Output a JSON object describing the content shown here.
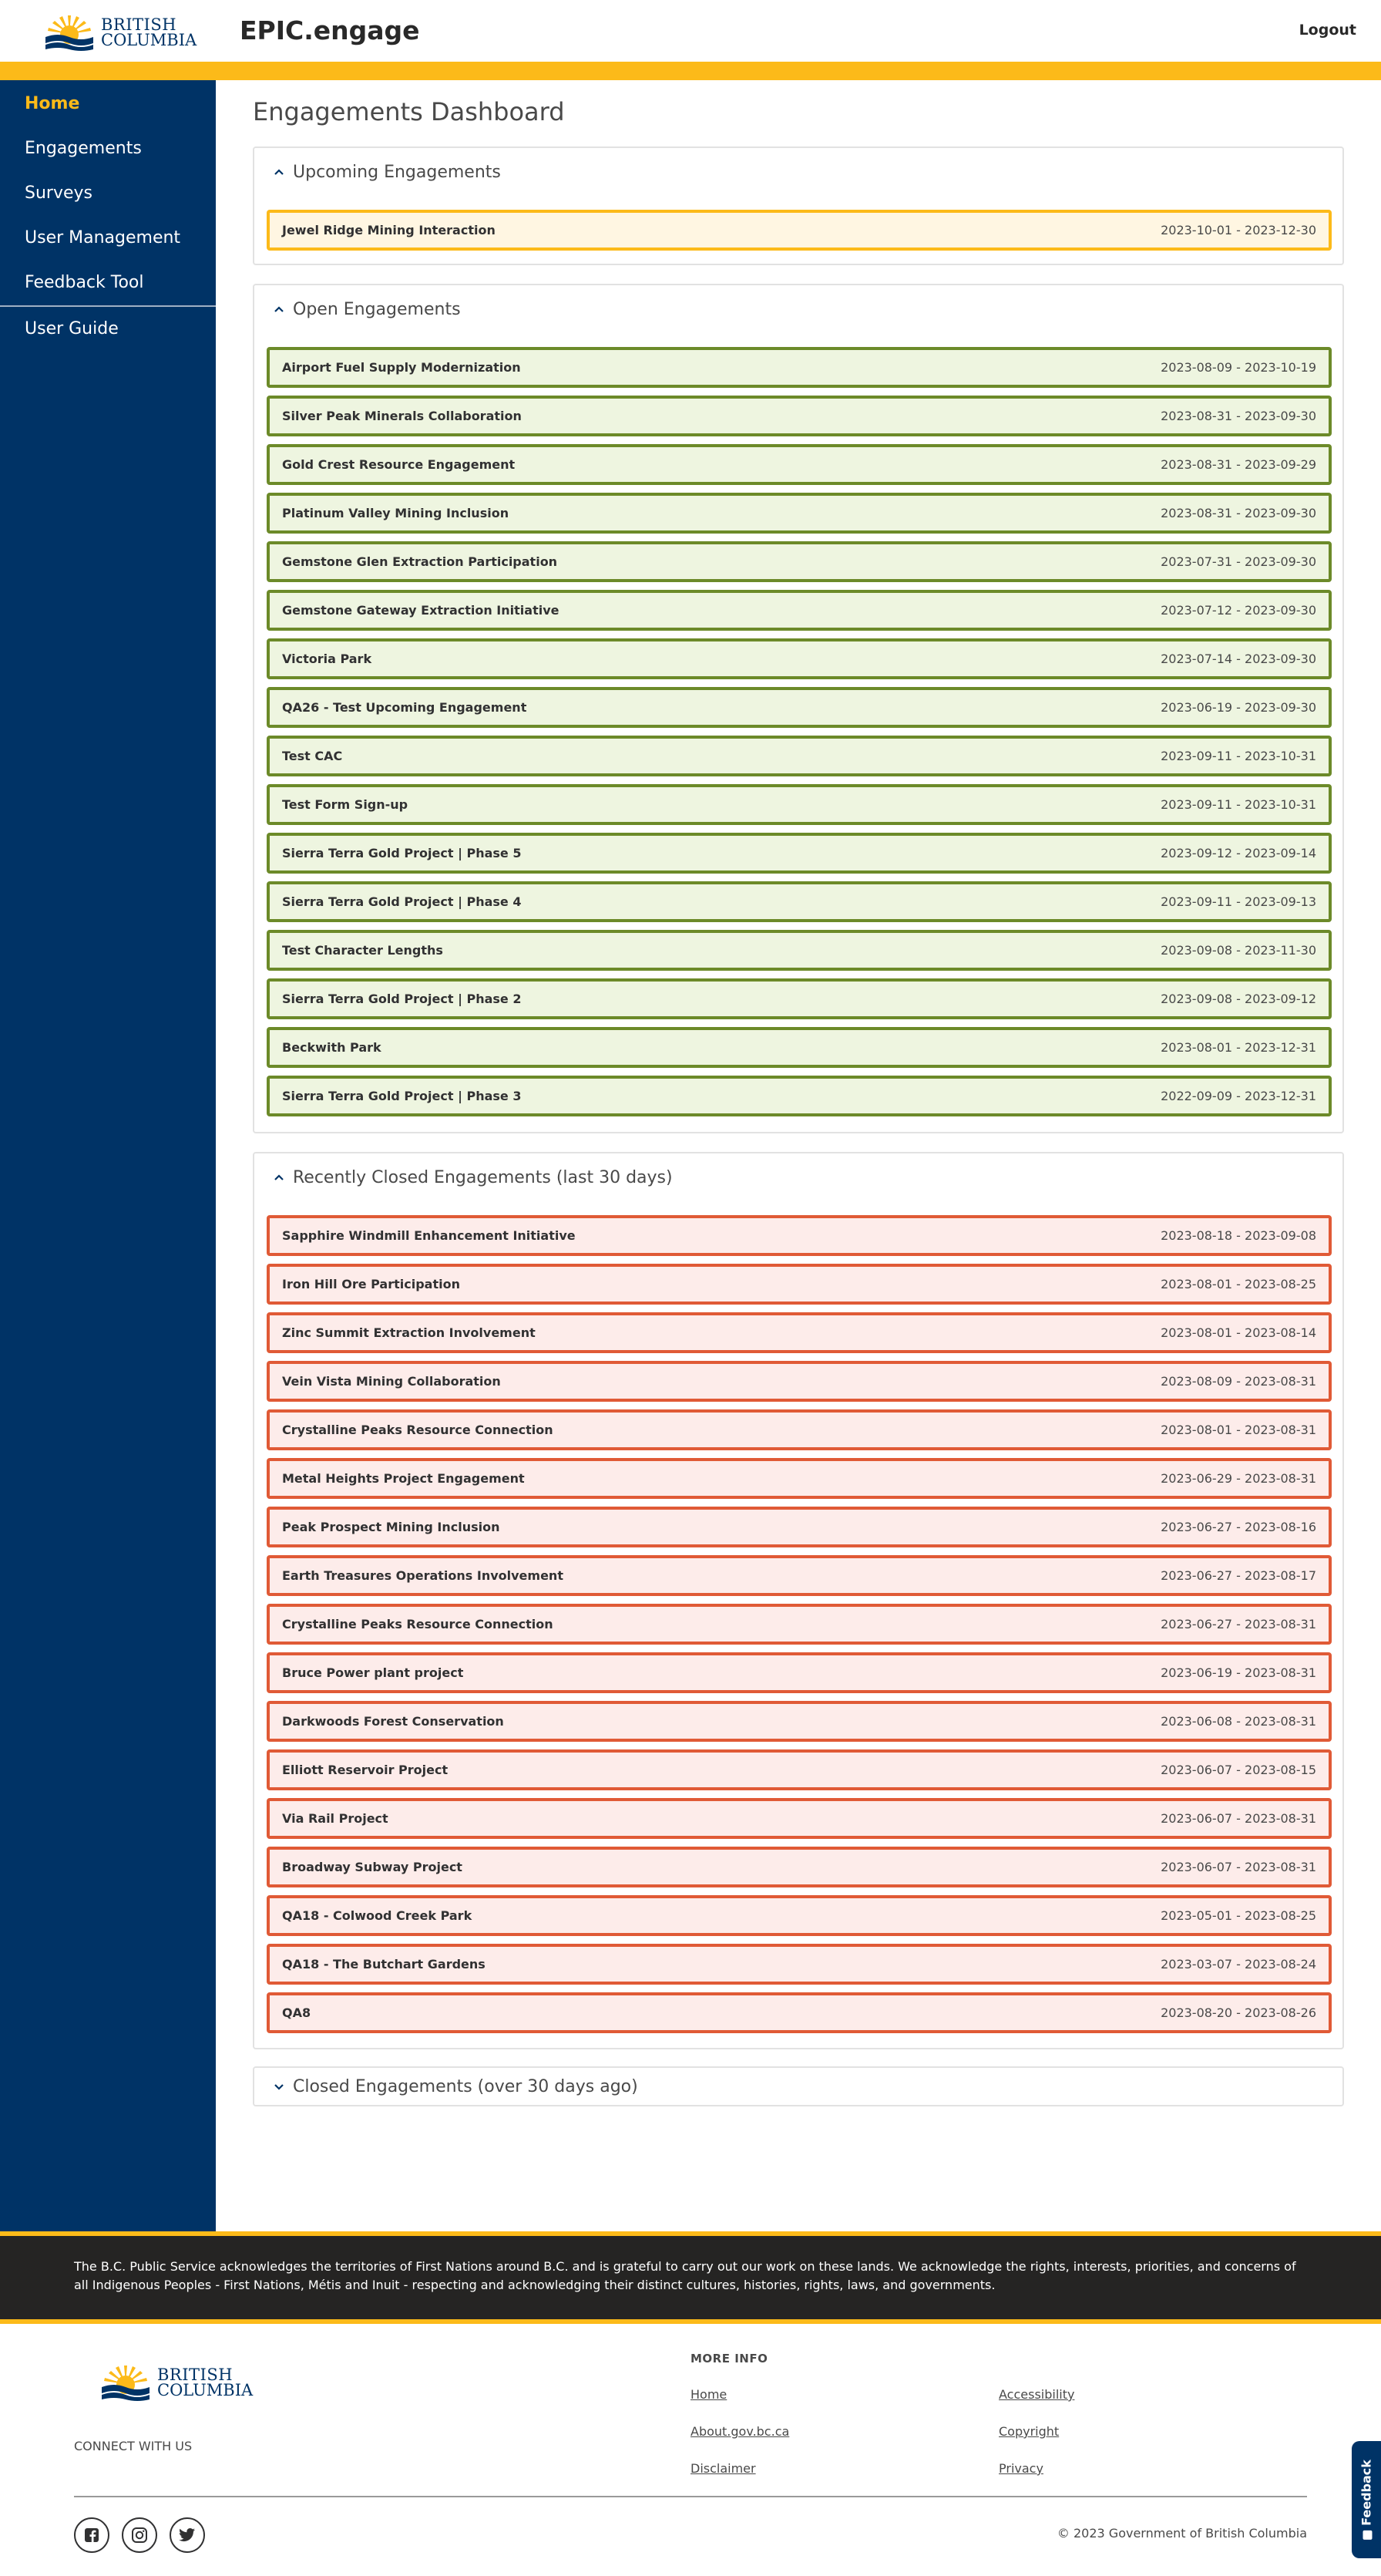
{
  "brand": {
    "logo_line1": "BRITISH",
    "logo_line2": "COLUMBIA",
    "app_title": "EPIC.engage",
    "logout_label": "Logout",
    "accent": "#fcba19",
    "navy": "#003366"
  },
  "sidebar": {
    "items": [
      {
        "label": "Home",
        "active": true
      },
      {
        "label": "Engagements"
      },
      {
        "label": "Surveys"
      },
      {
        "label": "User Management"
      },
      {
        "label": "Feedback Tool"
      },
      {
        "label": "User Guide"
      }
    ]
  },
  "page": {
    "title": "Engagements Dashboard"
  },
  "sections": {
    "upcoming": {
      "title": "Upcoming Engagements",
      "expanded": true,
      "items": [
        {
          "name": "Jewel Ridge Mining Interaction",
          "dates": "2023-10-01 - 2023-12-30"
        }
      ]
    },
    "open": {
      "title": "Open Engagements",
      "expanded": true,
      "items": [
        {
          "name": "Airport Fuel Supply Modernization",
          "dates": "2023-08-09 - 2023-10-19"
        },
        {
          "name": "Silver Peak Minerals Collaboration",
          "dates": "2023-08-31 - 2023-09-30"
        },
        {
          "name": "Gold Crest Resource Engagement",
          "dates": "2023-08-31 - 2023-09-29"
        },
        {
          "name": "Platinum Valley Mining Inclusion",
          "dates": "2023-08-31 - 2023-09-30"
        },
        {
          "name": "Gemstone Glen Extraction Participation",
          "dates": "2023-07-31 - 2023-09-30"
        },
        {
          "name": "Gemstone Gateway Extraction Initiative",
          "dates": "2023-07-12 - 2023-09-30"
        },
        {
          "name": "Victoria Park",
          "dates": "2023-07-14 - 2023-09-30"
        },
        {
          "name": "QA26 - Test Upcoming Engagement",
          "dates": "2023-06-19 - 2023-09-30"
        },
        {
          "name": "Test CAC",
          "dates": "2023-09-11 - 2023-10-31"
        },
        {
          "name": "Test Form Sign-up",
          "dates": "2023-09-11 - 2023-10-31"
        },
        {
          "name": "Sierra Terra Gold Project | Phase 5",
          "dates": "2023-09-12 - 2023-09-14"
        },
        {
          "name": "Sierra Terra Gold Project | Phase 4",
          "dates": "2023-09-11 - 2023-09-13"
        },
        {
          "name": "Test Character Lengths",
          "dates": "2023-09-08 - 2023-11-30"
        },
        {
          "name": "Sierra Terra Gold Project | Phase 2",
          "dates": "2023-09-08 - 2023-09-12"
        },
        {
          "name": "Beckwith Park",
          "dates": "2023-08-01 - 2023-12-31"
        },
        {
          "name": "Sierra Terra Gold Project | Phase 3",
          "dates": "2022-09-09 - 2023-12-31"
        }
      ]
    },
    "recent": {
      "title": "Recently Closed Engagements (last 30 days)",
      "expanded": true,
      "items": [
        {
          "name": "Sapphire Windmill Enhancement Initiative",
          "dates": "2023-08-18 - 2023-09-08"
        },
        {
          "name": "Iron Hill Ore Participation",
          "dates": "2023-08-01 - 2023-08-25"
        },
        {
          "name": "Zinc Summit Extraction Involvement",
          "dates": "2023-08-01 - 2023-08-14"
        },
        {
          "name": "Vein Vista Mining Collaboration",
          "dates": "2023-08-09 - 2023-08-31"
        },
        {
          "name": "Crystalline Peaks Resource Connection",
          "dates": "2023-08-01 - 2023-08-31"
        },
        {
          "name": "Metal Heights Project Engagement",
          "dates": "2023-06-29 - 2023-08-31"
        },
        {
          "name": "Peak Prospect Mining Inclusion",
          "dates": "2023-06-27 - 2023-08-16"
        },
        {
          "name": "Earth Treasures Operations Involvement",
          "dates": "2023-06-27 - 2023-08-17"
        },
        {
          "name": "Crystalline Peaks Resource Connection",
          "dates": "2023-06-27 - 2023-08-31"
        },
        {
          "name": "Bruce Power plant project",
          "dates": "2023-06-19 - 2023-08-31"
        },
        {
          "name": "Darkwoods Forest Conservation",
          "dates": "2023-06-08 - 2023-08-31"
        },
        {
          "name": "Elliott Reservoir Project",
          "dates": "2023-06-07 - 2023-08-15"
        },
        {
          "name": "Via Rail Project",
          "dates": "2023-06-07 - 2023-08-31"
        },
        {
          "name": "Broadway Subway Project",
          "dates": "2023-06-07 - 2023-08-31"
        },
        {
          "name": "QA18 - Colwood Creek Park",
          "dates": "2023-05-01 - 2023-08-25"
        },
        {
          "name": "QA18 - The Butchart Gardens",
          "dates": "2023-03-07 - 2023-08-24"
        },
        {
          "name": "QA8",
          "dates": "2023-08-20 - 2023-08-26"
        }
      ]
    },
    "closed": {
      "title": "Closed Engagements (over 30 days ago)",
      "expanded": false
    }
  },
  "acknowledgement": "The B.C. Public Service acknowledges the territories of First Nations around B.C. and is grateful to carry out our work on these lands. We acknowledge the rights, interests, priorities, and concerns of all Indigenous Peoples - First Nations, Métis and Inuit - respecting and acknowledging their distinct cultures, histories, rights, laws, and governments.",
  "footer": {
    "connect_label": "CONNECT WITH US",
    "more_info_label": "MORE INFO",
    "links": [
      "Home",
      "Accessibility",
      "About.gov.bc.ca",
      "Copyright",
      "Disclaimer",
      "Privacy"
    ],
    "social": [
      "facebook-icon",
      "instagram-icon",
      "twitter-icon"
    ],
    "copyright": "© 2023 Government of British Columbia"
  },
  "feedback_tab_label": "Feedback"
}
